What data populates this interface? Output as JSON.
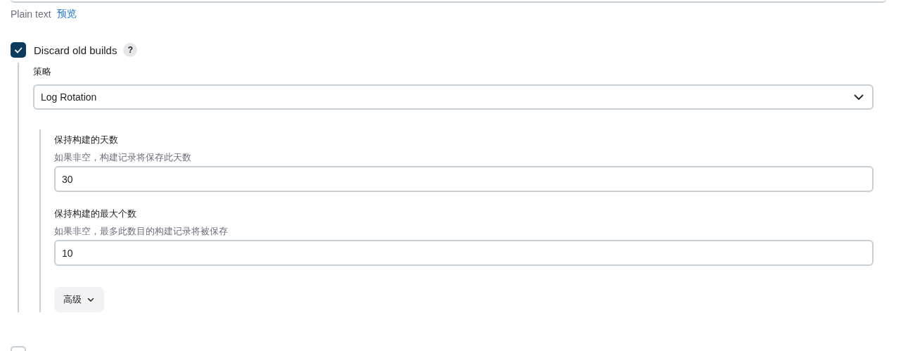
{
  "description_format": {
    "label": "Plain text",
    "preview_link": "预览"
  },
  "discard_old_builds": {
    "label": "Discard old builds",
    "checked": true,
    "help": "?",
    "strategy": {
      "label": "策略",
      "value": "Log Rotation"
    },
    "fields": [
      {
        "label": "保持构建的天数",
        "hint": "如果非空，构建记录将保存此天数",
        "value": "30"
      },
      {
        "label": "保持构建的最大个数",
        "hint": "如果非空，最多此数目的构建记录将被保存",
        "value": "10"
      }
    ],
    "advanced_button": "高级"
  },
  "next_option": {
    "checked": false
  }
}
